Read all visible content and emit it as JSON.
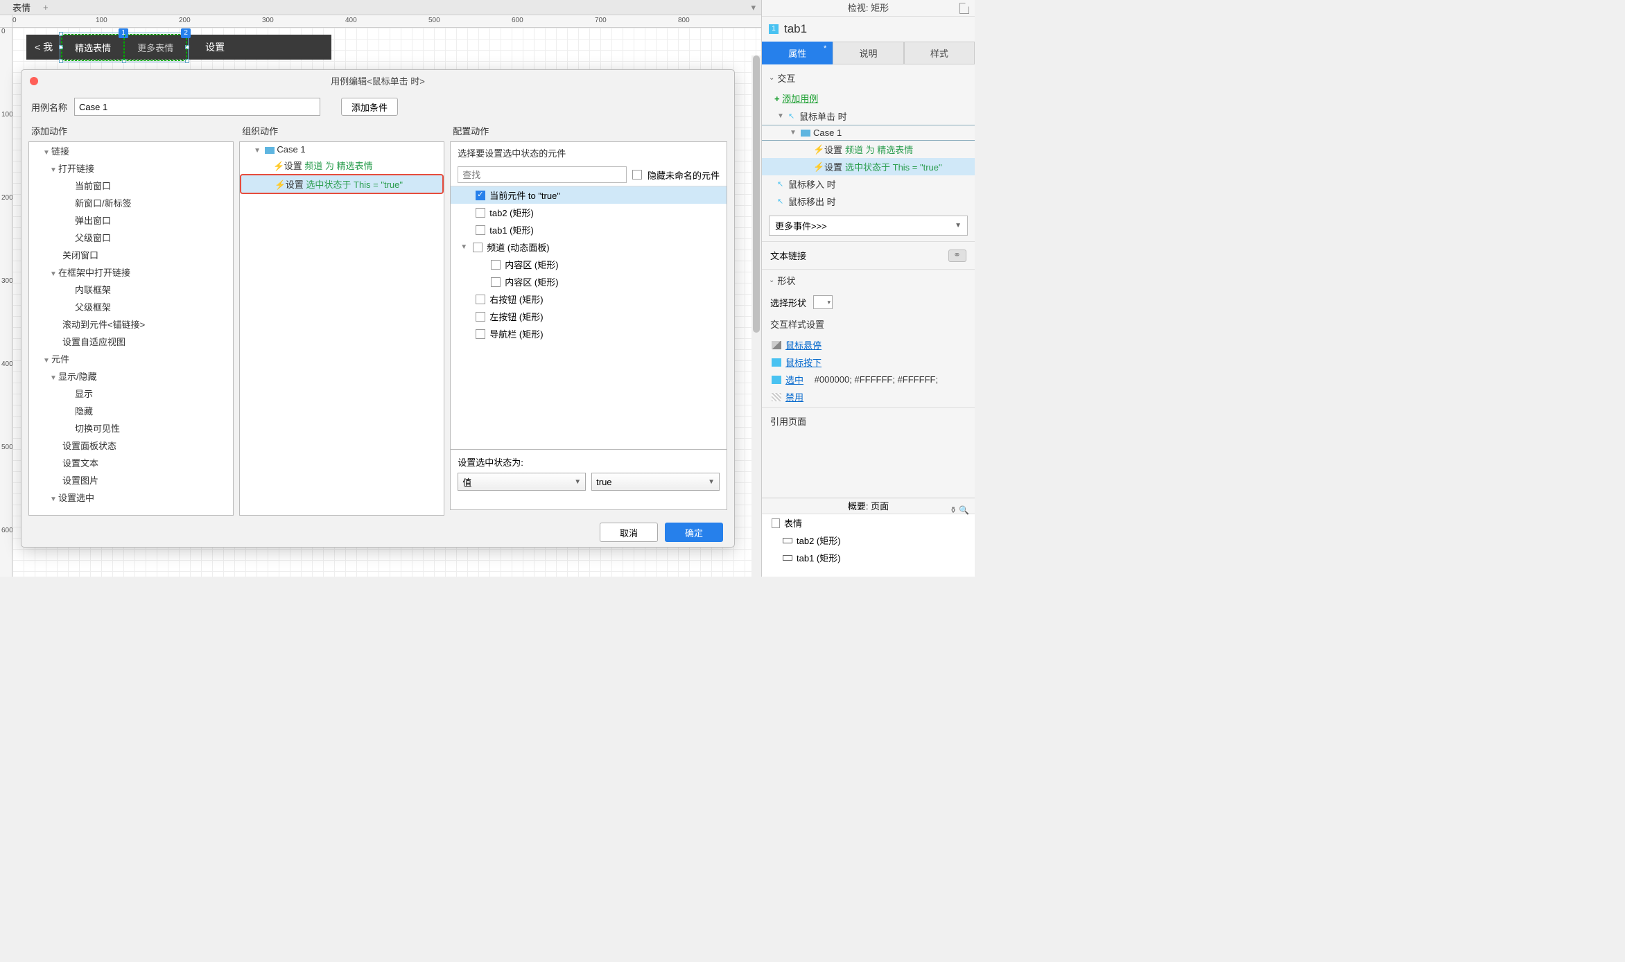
{
  "tabs": {
    "page_tab": "表情",
    "add": "+"
  },
  "ruler_h": [
    0,
    100,
    200,
    300,
    400,
    500,
    600,
    700,
    800
  ],
  "ruler_v": [
    0,
    100,
    200,
    300,
    400,
    500,
    600
  ],
  "canvas": {
    "back_label": "< 我",
    "tab1": "精选表情",
    "tab2": "更多表情",
    "settings": "设置",
    "badge1": "1",
    "badge2": "2"
  },
  "dialog": {
    "title": "用例编辑<鼠标单击 时>",
    "case_name_label": "用例名称",
    "case_name_value": "Case 1",
    "add_condition": "添加条件",
    "col1_title": "添加动作",
    "col2_title": "组织动作",
    "col3_title": "配置动作",
    "actions_tree": {
      "links": "链接",
      "open_link": "打开链接",
      "cur_window": "当前窗口",
      "new_window": "新窗口/新标签",
      "popup": "弹出窗口",
      "parent_window": "父级窗口",
      "close_window": "关闭窗口",
      "open_in_frame": "在框架中打开链接",
      "inline_frame": "内联框架",
      "parent_frame": "父级框架",
      "scroll_anchor": "滚动到元件<锚链接>",
      "adaptive": "设置自适应视图",
      "widgets": "元件",
      "show_hide": "显示/隐藏",
      "show": "显示",
      "hide": "隐藏",
      "toggle": "切换可见性",
      "panel_state": "设置面板状态",
      "set_text": "设置文本",
      "set_image": "设置图片",
      "set_selected": "设置选中"
    },
    "org": {
      "case1": "Case 1",
      "act1_prefix": "设置",
      "act1_green": "频道 为 精选表情",
      "act2_prefix": "设置",
      "act2_green": "选中状态于 This = \"true\""
    },
    "config": {
      "header": "选择要设置选中状态的元件",
      "search_placeholder": "查找",
      "hide_unnamed": "隐藏未命名的元件",
      "items": {
        "current": "当前元件 to \"true\"",
        "tab2": "tab2 (矩形)",
        "tab1": "tab1 (矩形)",
        "channel": "频道 (动态面板)",
        "content1": "内容区 (矩形)",
        "content2": "内容区 (矩形)",
        "right_btn": "右按钮 (矩形)",
        "left_btn": "左按钮 (矩形)",
        "nav": "导航栏 (矩形)"
      },
      "set_state_label": "设置选中状态为:",
      "select_value": "值",
      "select_true": "true"
    },
    "cancel": "取消",
    "ok": "确定"
  },
  "inspector": {
    "title": "检视: 矩形",
    "fn_num": "1",
    "widget_name": "tab1",
    "tab_props": "属性",
    "tab_notes": "说明",
    "tab_style": "样式",
    "interactions": "交互",
    "add_case": "添加用例",
    "on_click": "鼠标单击 时",
    "case1": "Case 1",
    "act1_prefix": "设置",
    "act1_green": "频道 为 精选表情",
    "act2_prefix": "设置",
    "act2_green": "选中状态于 This = \"true\"",
    "on_mouseenter": "鼠标移入 时",
    "on_mouseleave": "鼠标移出 时",
    "more_events": "更多事件>>>",
    "text_link": "文本链接",
    "shape_section": "形状",
    "select_shape": "选择形状",
    "ix_style": "交互样式设置",
    "hover": "鼠标悬停",
    "mousedown": "鼠标按下",
    "selected": "选中",
    "selected_style": "#000000; #FFFFFF; #FFFFFF;",
    "disabled": "禁用",
    "ref_page": "引用页面"
  },
  "outline": {
    "title": "概要: 页面",
    "page": "表情",
    "tab2": "tab2 (矩形)",
    "tab1": "tab1 (矩形)"
  }
}
